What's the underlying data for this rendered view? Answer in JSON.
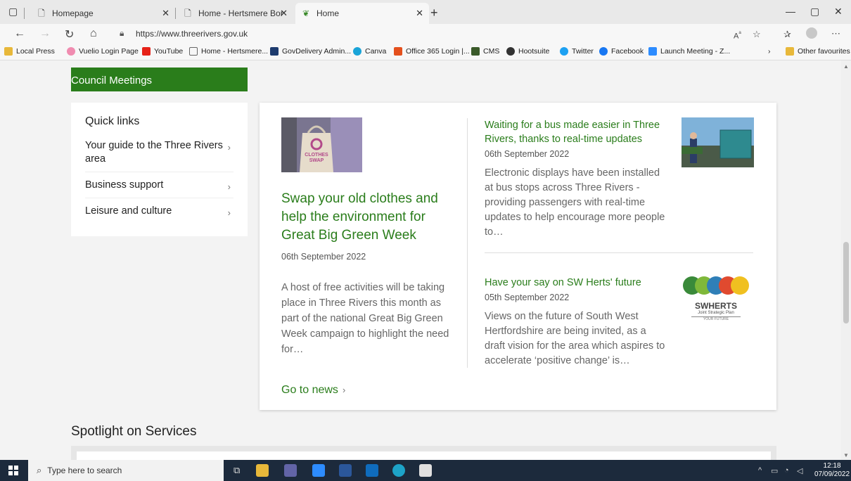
{
  "browser": {
    "tabs": [
      {
        "label": "Homepage"
      },
      {
        "label": "Home - Hertsmere Borough Cou"
      },
      {
        "label": "Home"
      }
    ],
    "url": "https://www.threerivers.gov.uk",
    "favourites": [
      {
        "label": "Local Press",
        "color": "#e8b83a"
      },
      {
        "label": "Vuelio Login Page",
        "color": "#f08cb0"
      },
      {
        "label": "YouTube",
        "color": "#e62117"
      },
      {
        "label": "Home - Hertsmere...",
        "color": "#ffffff"
      },
      {
        "label": "GovDelivery Admin...",
        "color": "#1d3b6e"
      },
      {
        "label": "Canva",
        "color": "#1aa4d8"
      },
      {
        "label": "Office 365 Login |...",
        "color": "#e4501d"
      },
      {
        "label": "CMS",
        "color": "#3a5a2a"
      },
      {
        "label": "Hootsuite",
        "color": "#333333"
      },
      {
        "label": "Twitter",
        "color": "#1da1f2"
      },
      {
        "label": "Facebook",
        "color": "#1877f2"
      },
      {
        "label": "Launch Meeting - Z...",
        "color": "#2d8cff"
      }
    ],
    "other_favourites": "Other favourites"
  },
  "page": {
    "council_meetings": "Council Meetings",
    "quick_links": {
      "title": "Quick links",
      "items": [
        {
          "label": "Your guide to the Three Rivers area"
        },
        {
          "label": "Business support"
        },
        {
          "label": "Leisure and culture"
        }
      ]
    },
    "news": {
      "featured": {
        "title": "Swap your old clothes and help the environment for Great Big Green Week",
        "date": "06th September 2022",
        "text": "A host of free activities will be taking place in Three Rivers this month as part of the national Great Big Green Week campaign to highlight the need for…",
        "image_text": "CLOTHES SWAP"
      },
      "articles": [
        {
          "title": "Waiting for a bus made easier in Three Rivers, thanks to real-time updates",
          "date": "06th September 2022",
          "text": "Electronic displays have been installed at bus stops across Three Rivers - providing passengers with real-time updates to help encourage more people to…"
        },
        {
          "title": "Have your say on SW Herts' future",
          "date": "05th September 2022",
          "text": "Views on the future of South West Hertfordshire are being invited, as a draft vision for the area which aspires to accelerate ‘positive change’ is…",
          "logo_text": "SWHERTS",
          "logo_sub": "Joint Strategic Plan",
          "logo_sub2": "YOUR FUTURE"
        }
      ],
      "go_to_news": "Go to news"
    },
    "spotlight": "Spotlight on Services"
  },
  "taskbar": {
    "search_placeholder": "Type here to search",
    "time": "12:18",
    "date": "07/09/2022"
  },
  "colors": {
    "green": "#2a7d1b"
  }
}
